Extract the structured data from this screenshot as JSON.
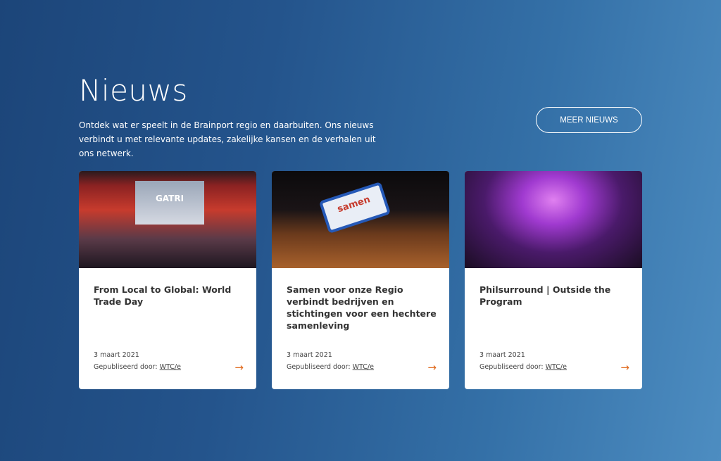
{
  "header": {
    "title": "Nieuws",
    "intro": "Ontdek wat er speelt in de Brainport regio en daarbuiten. Ons nieuws verbindt u met relevante updates, zakelijke kansen en de verhalen uit ons netwerk.",
    "more_label": "MEER NIEUWS"
  },
  "accent": "#e06a1d",
  "cards": [
    {
      "title": "From Local to Global: World Trade Day",
      "date": "3 maart 2021",
      "published_label": "Gepubliseerd door:",
      "author": "WTC/e",
      "image_text": "GATRI"
    },
    {
      "title": "Samen voor onze Regio verbindt bedrijven en stichtingen voor een hechtere samenleving",
      "date": "3 maart 2021",
      "published_label": "Gepubliseerd door:",
      "author": "WTC/e",
      "image_text": "samen"
    },
    {
      "title": "Philsurround | Outside the Program",
      "date": "3 maart 2021",
      "published_label": "Gepubliseerd door:",
      "author": "WTC/e"
    }
  ],
  "arrow": "→"
}
